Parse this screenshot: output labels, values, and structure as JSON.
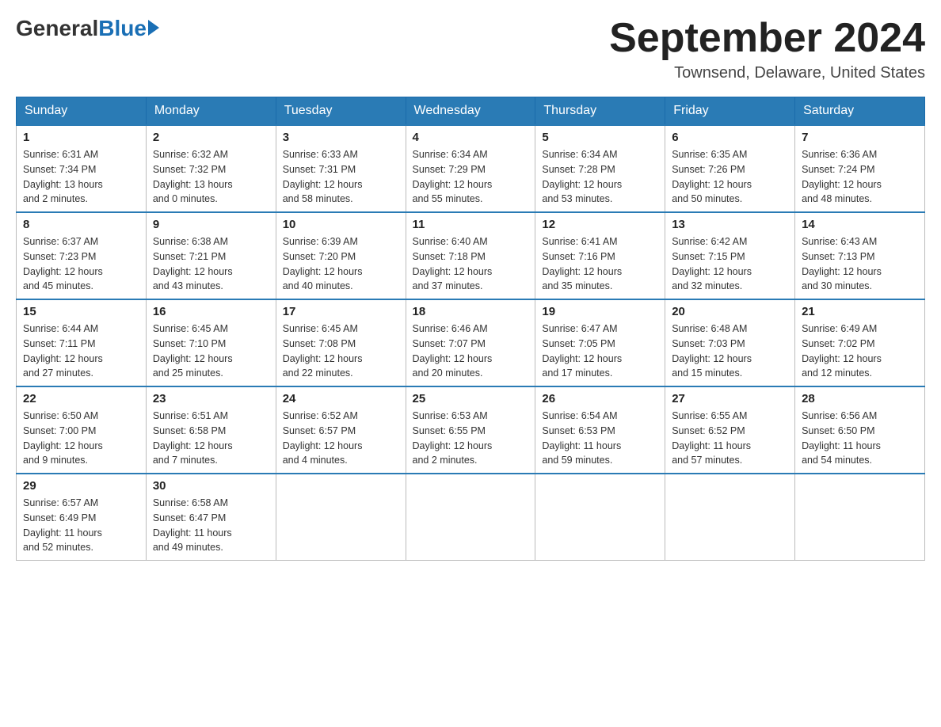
{
  "header": {
    "logo_general": "General",
    "logo_blue": "Blue",
    "month_title": "September 2024",
    "location": "Townsend, Delaware, United States"
  },
  "days_of_week": [
    "Sunday",
    "Monday",
    "Tuesday",
    "Wednesday",
    "Thursday",
    "Friday",
    "Saturday"
  ],
  "weeks": [
    [
      {
        "day": "1",
        "sunrise": "6:31 AM",
        "sunset": "7:34 PM",
        "daylight": "13 hours and 2 minutes."
      },
      {
        "day": "2",
        "sunrise": "6:32 AM",
        "sunset": "7:32 PM",
        "daylight": "13 hours and 0 minutes."
      },
      {
        "day": "3",
        "sunrise": "6:33 AM",
        "sunset": "7:31 PM",
        "daylight": "12 hours and 58 minutes."
      },
      {
        "day": "4",
        "sunrise": "6:34 AM",
        "sunset": "7:29 PM",
        "daylight": "12 hours and 55 minutes."
      },
      {
        "day": "5",
        "sunrise": "6:34 AM",
        "sunset": "7:28 PM",
        "daylight": "12 hours and 53 minutes."
      },
      {
        "day": "6",
        "sunrise": "6:35 AM",
        "sunset": "7:26 PM",
        "daylight": "12 hours and 50 minutes."
      },
      {
        "day": "7",
        "sunrise": "6:36 AM",
        "sunset": "7:24 PM",
        "daylight": "12 hours and 48 minutes."
      }
    ],
    [
      {
        "day": "8",
        "sunrise": "6:37 AM",
        "sunset": "7:23 PM",
        "daylight": "12 hours and 45 minutes."
      },
      {
        "day": "9",
        "sunrise": "6:38 AM",
        "sunset": "7:21 PM",
        "daylight": "12 hours and 43 minutes."
      },
      {
        "day": "10",
        "sunrise": "6:39 AM",
        "sunset": "7:20 PM",
        "daylight": "12 hours and 40 minutes."
      },
      {
        "day": "11",
        "sunrise": "6:40 AM",
        "sunset": "7:18 PM",
        "daylight": "12 hours and 37 minutes."
      },
      {
        "day": "12",
        "sunrise": "6:41 AM",
        "sunset": "7:16 PM",
        "daylight": "12 hours and 35 minutes."
      },
      {
        "day": "13",
        "sunrise": "6:42 AM",
        "sunset": "7:15 PM",
        "daylight": "12 hours and 32 minutes."
      },
      {
        "day": "14",
        "sunrise": "6:43 AM",
        "sunset": "7:13 PM",
        "daylight": "12 hours and 30 minutes."
      }
    ],
    [
      {
        "day": "15",
        "sunrise": "6:44 AM",
        "sunset": "7:11 PM",
        "daylight": "12 hours and 27 minutes."
      },
      {
        "day": "16",
        "sunrise": "6:45 AM",
        "sunset": "7:10 PM",
        "daylight": "12 hours and 25 minutes."
      },
      {
        "day": "17",
        "sunrise": "6:45 AM",
        "sunset": "7:08 PM",
        "daylight": "12 hours and 22 minutes."
      },
      {
        "day": "18",
        "sunrise": "6:46 AM",
        "sunset": "7:07 PM",
        "daylight": "12 hours and 20 minutes."
      },
      {
        "day": "19",
        "sunrise": "6:47 AM",
        "sunset": "7:05 PM",
        "daylight": "12 hours and 17 minutes."
      },
      {
        "day": "20",
        "sunrise": "6:48 AM",
        "sunset": "7:03 PM",
        "daylight": "12 hours and 15 minutes."
      },
      {
        "day": "21",
        "sunrise": "6:49 AM",
        "sunset": "7:02 PM",
        "daylight": "12 hours and 12 minutes."
      }
    ],
    [
      {
        "day": "22",
        "sunrise": "6:50 AM",
        "sunset": "7:00 PM",
        "daylight": "12 hours and 9 minutes."
      },
      {
        "day": "23",
        "sunrise": "6:51 AM",
        "sunset": "6:58 PM",
        "daylight": "12 hours and 7 minutes."
      },
      {
        "day": "24",
        "sunrise": "6:52 AM",
        "sunset": "6:57 PM",
        "daylight": "12 hours and 4 minutes."
      },
      {
        "day": "25",
        "sunrise": "6:53 AM",
        "sunset": "6:55 PM",
        "daylight": "12 hours and 2 minutes."
      },
      {
        "day": "26",
        "sunrise": "6:54 AM",
        "sunset": "6:53 PM",
        "daylight": "11 hours and 59 minutes."
      },
      {
        "day": "27",
        "sunrise": "6:55 AM",
        "sunset": "6:52 PM",
        "daylight": "11 hours and 57 minutes."
      },
      {
        "day": "28",
        "sunrise": "6:56 AM",
        "sunset": "6:50 PM",
        "daylight": "11 hours and 54 minutes."
      }
    ],
    [
      {
        "day": "29",
        "sunrise": "6:57 AM",
        "sunset": "6:49 PM",
        "daylight": "11 hours and 52 minutes."
      },
      {
        "day": "30",
        "sunrise": "6:58 AM",
        "sunset": "6:47 PM",
        "daylight": "11 hours and 49 minutes."
      },
      null,
      null,
      null,
      null,
      null
    ]
  ],
  "labels": {
    "sunrise": "Sunrise:",
    "sunset": "Sunset:",
    "daylight": "Daylight:"
  }
}
